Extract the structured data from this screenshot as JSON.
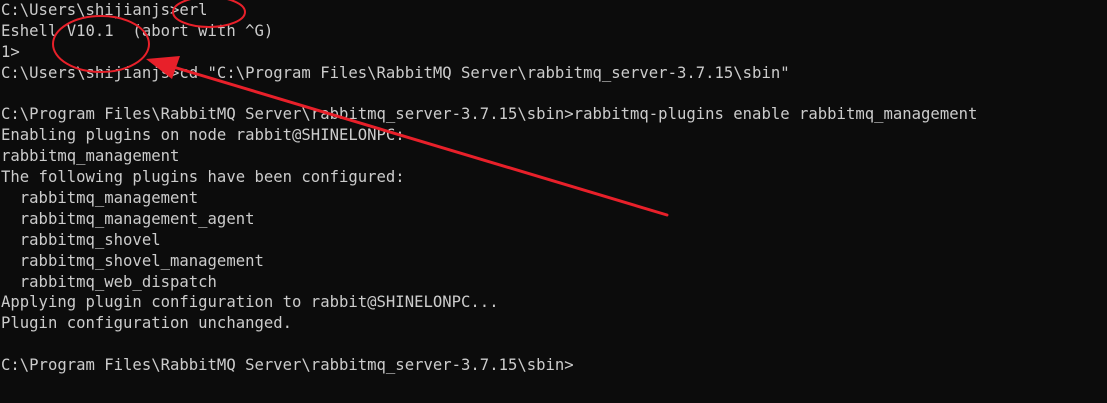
{
  "terminal": {
    "lines": [
      "C:\\Users\\shijianjs>erl",
      "Eshell V10.1  (abort with ^G)",
      "1>",
      "C:\\Users\\shijianjs>cd \"C:\\Program Files\\RabbitMQ Server\\rabbitmq_server-3.7.15\\sbin\"",
      "",
      "C:\\Program Files\\RabbitMQ Server\\rabbitmq_server-3.7.15\\sbin>rabbitmq-plugins enable rabbitmq_management",
      "Enabling plugins on node rabbit@SHINELONPC:",
      "rabbitmq_management",
      "The following plugins have been configured:",
      "  rabbitmq_management",
      "  rabbitmq_management_agent",
      "  rabbitmq_shovel",
      "  rabbitmq_shovel_management",
      "  rabbitmq_web_dispatch",
      "Applying plugin configuration to rabbit@SHINELONPC...",
      "Plugin configuration unchanged.",
      "",
      "C:\\Program Files\\RabbitMQ Server\\rabbitmq_server-3.7.15\\sbin>"
    ]
  },
  "theme": {
    "background": "#0c0c0c",
    "foreground": "#cccccc",
    "annotation_color": "#e8202a"
  }
}
